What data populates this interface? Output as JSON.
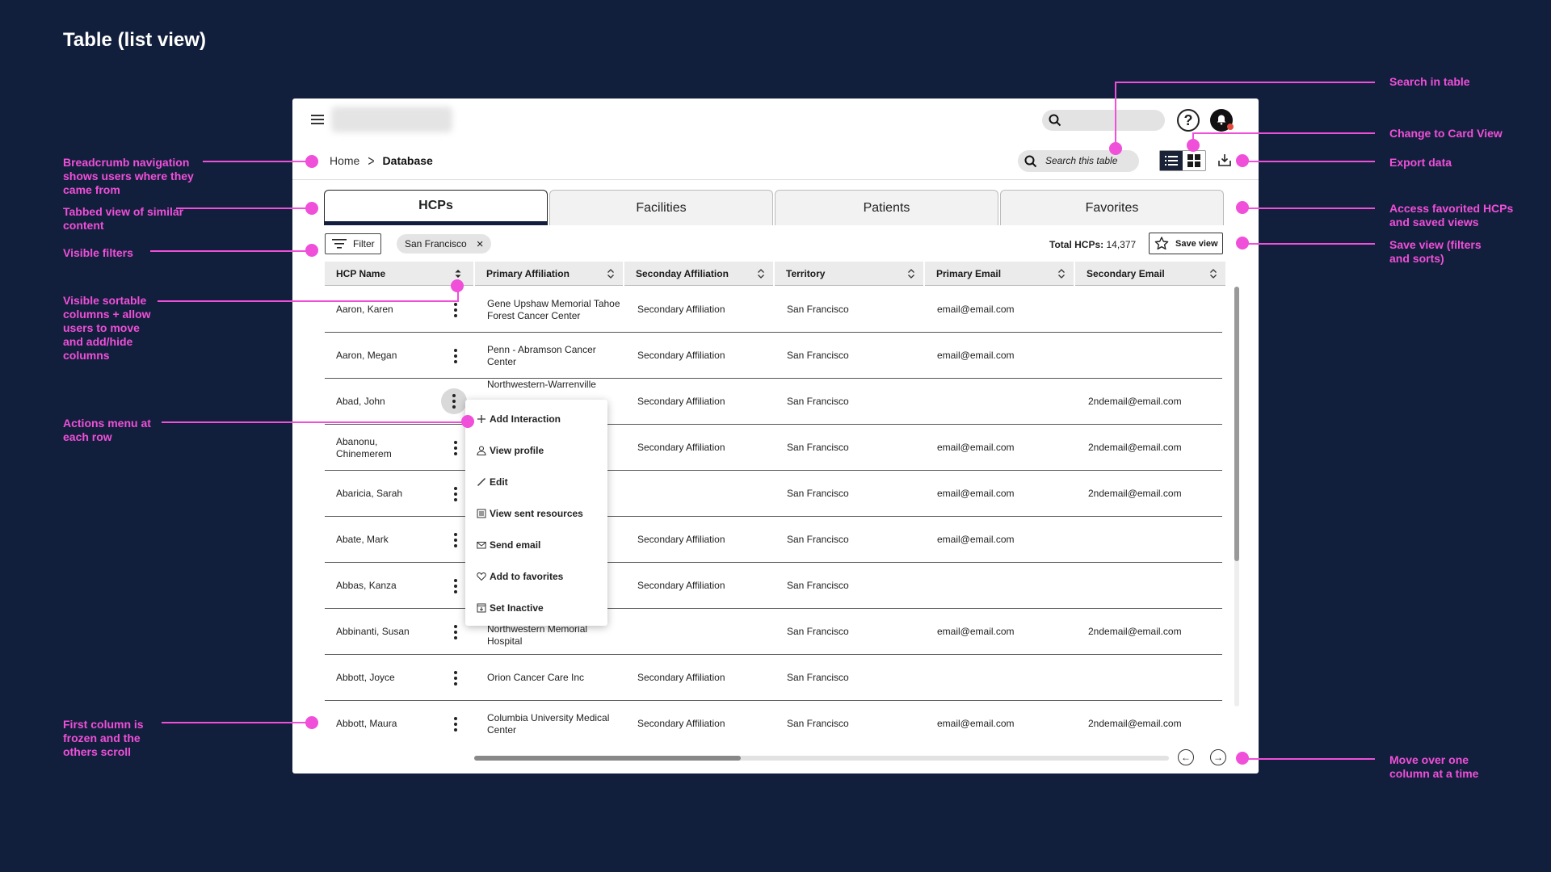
{
  "page_title": "Table (list view)",
  "annotations": {
    "search_in_table": "Search in table",
    "change_to_card": "Change to Card View",
    "export": "Export data",
    "favorites": "Access favorited HCPs and saved views",
    "save_view": "Save view (filters and sorts)",
    "move_column": "Move over one column at a time",
    "breadcrumb": "Breadcrumb navigation shows users where they came from",
    "tabbed": "Tabbed view of similar content",
    "filters": "Visible filters",
    "sortable": "Visible sortable columns + allow users to move and add/hide columns",
    "actions": "Actions menu at each row",
    "frozen": "First column is frozen and the others scroll"
  },
  "breadcrumb": {
    "home": "Home",
    "current": "Database"
  },
  "search": {
    "table_placeholder": "Search this table"
  },
  "tabs": [
    "HCPs",
    "Facilities",
    "Patients",
    "Favorites"
  ],
  "filter": {
    "label": "Filter",
    "chip": "San Francisco",
    "chip_remove": "×"
  },
  "total": {
    "label": "Total HCPs:",
    "value": "14,377"
  },
  "save_view": "Save view",
  "columns": [
    "HCP Name",
    "Primary Affiliation",
    "Seconday Affiliation",
    "Territory",
    "Primary Email",
    "Secondary Email"
  ],
  "rows": [
    {
      "name": "Aaron, Karen",
      "primary": "Gene Upshaw Memorial Tahoe Forest Cancer Center",
      "secondary": "Secondary Affiliation",
      "territory": "San Francisco",
      "email": "email@email.com",
      "email2": ""
    },
    {
      "name": "Aaron, Megan",
      "primary": "Penn - Abramson Cancer Center",
      "secondary": "Secondary Affiliation",
      "territory": "San Francisco",
      "email": "email@email.com",
      "email2": ""
    },
    {
      "name": "Abad, John",
      "primary": "Northwestern-Warrenville",
      "secondary": "Secondary Affiliation",
      "territory": "San Francisco",
      "email": "",
      "email2": "2ndemail@email.com"
    },
    {
      "name": "Abanonu, Chinemerem",
      "primary": "",
      "secondary": "Secondary Affiliation",
      "territory": "San Francisco",
      "email": "email@email.com",
      "email2": "2ndemail@email.com"
    },
    {
      "name": "Abaricia, Sarah",
      "primary": "",
      "secondary": "",
      "territory": "San Francisco",
      "email": "email@email.com",
      "email2": "2ndemail@email.com"
    },
    {
      "name": "Abate, Mark",
      "primary": "",
      "secondary": "Secondary Affiliation",
      "territory": "San Francisco",
      "email": "email@email.com",
      "email2": ""
    },
    {
      "name": "Abbas, Kanza",
      "primary": "",
      "secondary": "Secondary Affiliation",
      "territory": "San Francisco",
      "email": "",
      "email2": ""
    },
    {
      "name": "Abbinanti, Susan",
      "primary": "Northwestern Memorial Hospital",
      "secondary": "",
      "territory": "San Francisco",
      "email": "email@email.com",
      "email2": "2ndemail@email.com"
    },
    {
      "name": "Abbott, Joyce",
      "primary": "Orion Cancer Care Inc",
      "secondary": "Secondary Affiliation",
      "territory": "San Francisco",
      "email": "",
      "email2": ""
    },
    {
      "name": "Abbott, Maura",
      "primary": "Columbia University Medical Center",
      "secondary": "Secondary Affiliation",
      "territory": "San Francisco",
      "email": "email@email.com",
      "email2": "2ndemail@email.com"
    }
  ],
  "context_menu": [
    {
      "label": "Add Interaction",
      "icon": "plus-icon"
    },
    {
      "label": "View profile",
      "icon": "user-icon"
    },
    {
      "label": "Edit",
      "icon": "pencil-icon"
    },
    {
      "label": "View sent resources",
      "icon": "document-icon"
    },
    {
      "label": "Send email",
      "icon": "mail-icon"
    },
    {
      "label": "Add to favorites",
      "icon": "heart-icon"
    },
    {
      "label": "Set Inactive",
      "icon": "archive-icon"
    }
  ],
  "colors": {
    "background": "#121f3c",
    "annotation": "#f04fd9",
    "active_tab_border": "#121f3c"
  }
}
